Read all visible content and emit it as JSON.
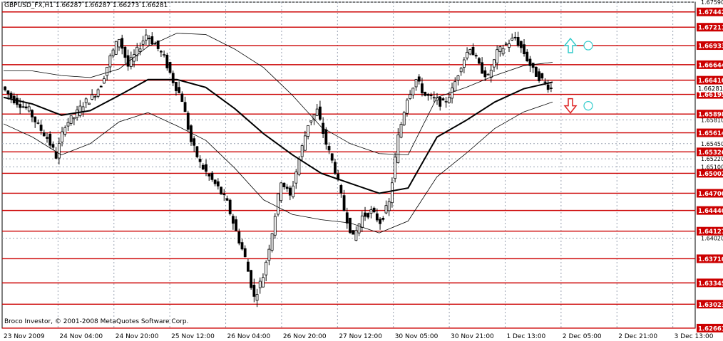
{
  "header": {
    "symbol": "GBPUSD_FX,H1",
    "ohlc": "1.66287 1.66287 1.66273 1.66281"
  },
  "copyright": "Broco Investor, © 2001-2008 MetaQuotes Software Corp.",
  "chart_data": {
    "type": "candlestick",
    "title": "GBPUSD_FX,H1",
    "ylim": [
      1.6266,
      1.6759
    ],
    "x_ticks": [
      "23 Nov 2009",
      "24 Nov 04:00",
      "24 Nov 20:00",
      "25 Nov 12:00",
      "26 Nov 04:00",
      "26 Nov 20:00",
      "27 Nov 12:00",
      "30 Nov 05:00",
      "30 Nov 21:00",
      "1 Dec 13:00",
      "2 Dec 05:00",
      "2 Dec 21:00",
      "3 Dec 13:00"
    ],
    "y_ticks": [
      "1.67590",
      "1.65220",
      "1.65810",
      "1.65450",
      "1.65100",
      "1.64020"
    ],
    "levels": [
      {
        "value": 1.67442,
        "label": "1.67442"
      },
      {
        "value": 1.67211,
        "label": "1.67211"
      },
      {
        "value": 1.66933,
        "label": "1.66933"
      },
      {
        "value": 1.66644,
        "label": "1.66644"
      },
      {
        "value": 1.6641,
        "label": "1.66410"
      },
      {
        "value": 1.66195,
        "label": "1.66195"
      },
      {
        "value": 1.65898,
        "label": "1.65898"
      },
      {
        "value": 1.65614,
        "label": "1.65614"
      },
      {
        "value": 1.65326,
        "label": "1.65326"
      },
      {
        "value": 1.65002,
        "label": "1.65002"
      },
      {
        "value": 1.647,
        "label": "1.64700"
      },
      {
        "value": 1.6444,
        "label": "1.64440"
      },
      {
        "value": 1.64127,
        "label": "1.64127"
      },
      {
        "value": 1.6371,
        "label": "1.63710"
      },
      {
        "value": 1.63345,
        "label": "1.63345"
      },
      {
        "value": 1.63023,
        "label": "1.63023"
      },
      {
        "value": 1.62661,
        "label": "1.62661"
      }
    ],
    "current_price": "1.66281",
    "price_path": [
      1.6631,
      1.6615,
      1.6605,
      1.6595,
      1.6572,
      1.6554,
      1.6526,
      1.6575,
      1.6585,
      1.6605,
      1.6615,
      1.6635,
      1.6675,
      1.6705,
      1.6662,
      1.6685,
      1.671,
      1.6695,
      1.6675,
      1.664,
      1.6612,
      1.6548,
      1.6515,
      1.6495,
      1.6478,
      1.6455,
      1.6412,
      1.6372,
      1.6312,
      1.6345,
      1.6412,
      1.649,
      1.6465,
      1.6522,
      1.6575,
      1.6595,
      1.6545,
      1.6505,
      1.6445,
      1.6402,
      1.6435,
      1.6442,
      1.6427,
      1.6455,
      1.6555,
      1.6615,
      1.6642,
      1.6618,
      1.6612,
      1.6605,
      1.6625,
      1.6665,
      1.6692,
      1.6662,
      1.6645,
      1.6682,
      1.6695,
      1.6705,
      1.6682,
      1.6655,
      1.6641,
      1.6628
    ],
    "ma_path": [
      1.6615,
      1.6605,
      1.6588,
      1.6595,
      1.6618,
      1.6642,
      1.6642,
      1.663,
      1.6598,
      1.656,
      1.6528,
      1.65,
      1.6485,
      1.647,
      1.6478,
      1.6555,
      1.658,
      1.6608,
      1.6628,
      1.6638
    ],
    "arrows": [
      {
        "direction": "up",
        "value": 1.66933
      },
      {
        "direction": "down",
        "value": 1.66195
      }
    ],
    "colors": {
      "level_line": "#cc0000",
      "level_label_bg": "#cc0000",
      "level_label_text": "#ffffff",
      "grid": "#9aa3b2",
      "candle": "#000000",
      "ma": "#000000",
      "arrow_up": "#33cccc",
      "arrow_down": "#dd2222"
    }
  }
}
